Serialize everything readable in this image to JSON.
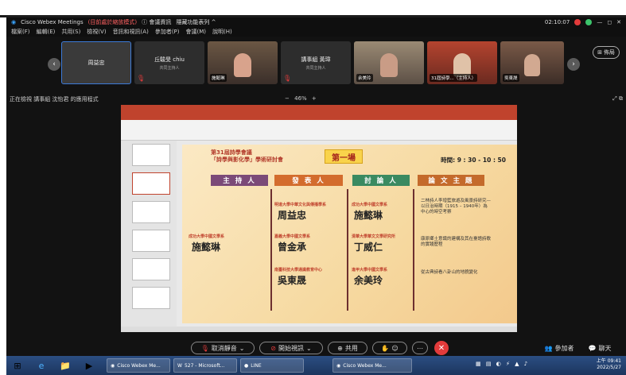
{
  "window": {
    "app_title": "Cisco Webex Meetings",
    "mode_label": "(目前處於縮放模式)",
    "meeting_info": "會議資訊",
    "hide_controls": "隱藏功能表列 ^",
    "clock": "02:10:07"
  },
  "menu": [
    "檔案(F)",
    "編輯(E)",
    "共用(S)",
    "檢視(V)",
    "音訊和視訊(A)",
    "參加者(P)",
    "會議(M)",
    "說明(H)"
  ],
  "participants": [
    {
      "name": "周益忠",
      "sub": ""
    },
    {
      "name": "丘駿旻 chiu",
      "sub": "共同主持人"
    },
    {
      "name": "施懿琳",
      "sub": ""
    },
    {
      "name": "講事組 黃瑋",
      "sub": "共同主持人"
    },
    {
      "name": "余美玲",
      "sub": ""
    },
    {
      "name": "31屆詩學...（主持人）",
      "sub": ""
    },
    {
      "name": "吳東晟",
      "sub": ""
    }
  ],
  "share_label": "佈局",
  "viewing_text": "正在檢視 講事組 沈怡君 的應用程式",
  "zoom": {
    "minus": "−",
    "value": "46%",
    "plus": "+"
  },
  "slide": {
    "conf_title_line1": "第31屆詩學會議",
    "conf_title_line2": "「詩學與影化學」學術研討會",
    "session": "第一場",
    "time": "時間: 9 : 30 - 10 : 50",
    "headers": [
      "主 持 人",
      "發 表 人",
      "討 論 人",
      "論 文 主 題"
    ],
    "host_aff": "成功大學中國文學系",
    "host_name": "施懿琳",
    "rows": [
      {
        "presenter_aff": "明道大學中華文化與傳播學系",
        "presenter": "周益忠",
        "discussant_aff": "成功大學中國文學系",
        "discussant": "施懿琳",
        "topic": "二林詩人李增藍旅遊及風景詩研究—以日治時期（1915 – 1940年）為中心的時空考察"
      },
      {
        "presenter_aff": "嘉義大學中國文學系",
        "presenter": "曾金承",
        "discussant_aff": "清華大學華文文學研究所",
        "discussant": "丁威仁",
        "topic": "康原鄉土意識的建構及其在臺語詩歌的實踐歷程"
      },
      {
        "presenter_aff": "南臺科技大學通識教育中心",
        "presenter": "吳東晟",
        "discussant_aff": "逢甲大學中國文學系",
        "discussant": "余美玲",
        "topic": "從古典詩看八卦山的地貌變化"
      }
    ]
  },
  "controls": {
    "mute": "取消靜音",
    "video": "開始視訊",
    "share": "共用",
    "participants": "參加者",
    "chat": "聊天"
  },
  "taskbar": {
    "tasks": [
      "Cisco Webex Me...",
      "527 - Microsoft...",
      "LINE",
      "Cisco Webex Me..."
    ],
    "time": "上午 09:41",
    "date": "2022/5/27"
  }
}
